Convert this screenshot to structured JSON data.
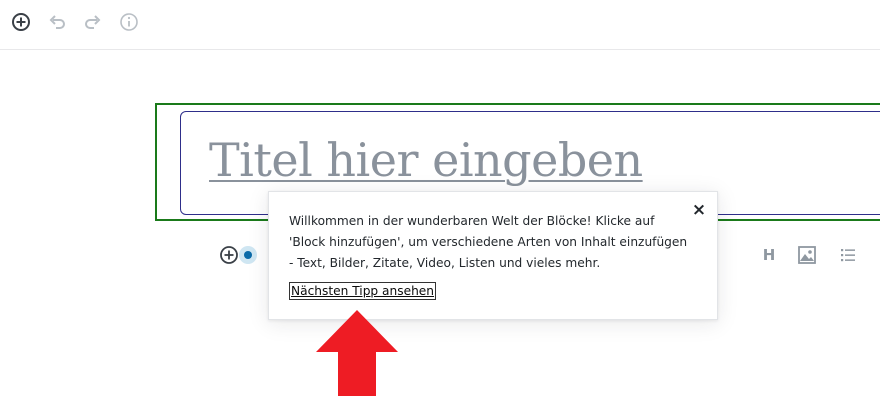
{
  "toolbar": {
    "add_icon": "plus-circle-icon",
    "undo_icon": "undo-icon",
    "redo_icon": "redo-icon",
    "info_icon": "info-icon"
  },
  "editor": {
    "title_placeholder": "Titel hier eingeben"
  },
  "quick_inserter": {
    "heading_icon_label": "H",
    "image_icon": "image-icon",
    "list_icon": "list-icon"
  },
  "tip": {
    "text": "Willkommen in der wunderbaren Welt der Blöcke! Klicke auf 'Block hinzufügen', um verschiedene Arten von Inhalt einzufügen - Text, Bilder, Zitate, Video, Listen und vieles mehr.",
    "next_tip_label": "Nächsten Tipp ansehen",
    "close_label": "×"
  },
  "annotation": {
    "arrow_color": "#ee1c24"
  }
}
